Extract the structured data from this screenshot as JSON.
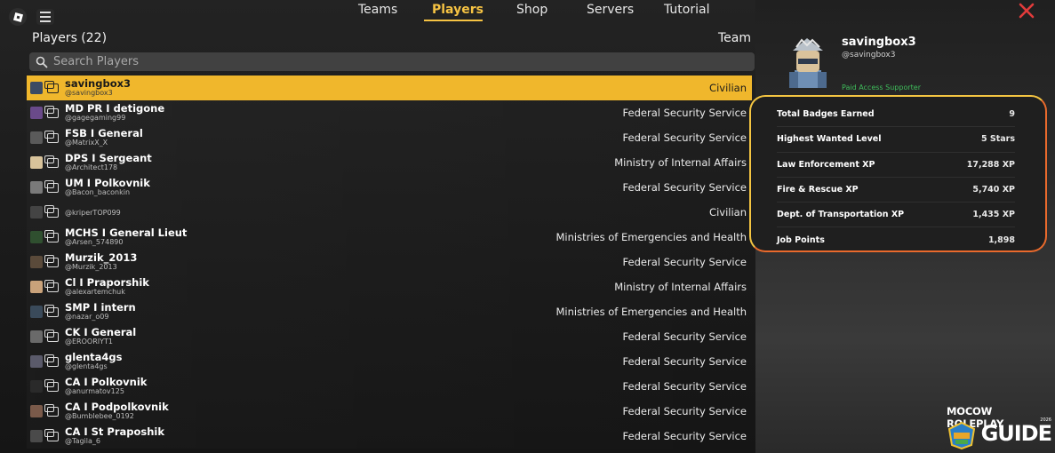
{
  "nav": {
    "tabs": [
      {
        "label": "Teams",
        "active": false
      },
      {
        "label": "Players",
        "active": true
      },
      {
        "label": "Shop",
        "active": false
      },
      {
        "label": "Servers",
        "active": false
      },
      {
        "label": "Tutorial",
        "active": false
      }
    ],
    "accent_color": "#f6c343",
    "close_color": "#e23b3b"
  },
  "players": {
    "title": "Players (22)",
    "team_header": "Team",
    "search_placeholder": "Search Players",
    "rows": [
      {
        "display": "savingbox3",
        "user": "@savingbox3",
        "team": "Civilian",
        "selected": true
      },
      {
        "display": "MD PR I detigone",
        "user": "@gagegaming99",
        "team": "Federal Security Service"
      },
      {
        "display": "FSB I General",
        "user": "@MatrixX_X",
        "team": "Federal Security Service"
      },
      {
        "display": "DPS I Sergeant",
        "user": "@Architect178",
        "team": "Ministry of Internal Affairs"
      },
      {
        "display": "UM I Polkovnik",
        "user": "@Bacon_baconkin",
        "team": "Federal Security Service"
      },
      {
        "display": "",
        "user": "@kriperTOP099",
        "team": "Civilian"
      },
      {
        "display": "MCHS I General Lieut",
        "user": "@Arsen_574890",
        "team": "Ministries of Emergencies and Health"
      },
      {
        "display": "Murzik_2013",
        "user": "@Murzik_2013",
        "team": "Federal Security Service"
      },
      {
        "display": "Cl I Praporshik",
        "user": "@alexartemchuk",
        "team": "Ministry of Internal Affairs"
      },
      {
        "display": "SMP I intern",
        "user": "@nazar_o09",
        "team": "Ministries of Emergencies and Health"
      },
      {
        "display": "CK I General",
        "user": "@EROORIYT1",
        "team": "Federal Security Service"
      },
      {
        "display": "glenta4gs",
        "user": "@glenta4gs",
        "team": "Federal Security Service"
      },
      {
        "display": "CA I Polkovnik",
        "user": "@anurmatov125",
        "team": "Federal Security Service"
      },
      {
        "display": "CA I Podpolkovnik",
        "user": "@Bumblebee_0192",
        "team": "Federal Security Service"
      },
      {
        "display": "CA I St Praposhik",
        "user": "@Tagila_6",
        "team": "Federal Security Service"
      }
    ]
  },
  "profile": {
    "name": "savingbox3",
    "user": "@savingbox3",
    "badge": "Paid Access Supporter",
    "stats": [
      {
        "label": "Total Badges Earned",
        "value": "9"
      },
      {
        "label": "Highest Wanted Level",
        "value": "5 Stars"
      },
      {
        "label": "Law Enforcement XP",
        "value": "17,288 XP"
      },
      {
        "label": "Fire & Rescue XP",
        "value": "5,740 XP"
      },
      {
        "label": "Dept. of Transportation XP",
        "value": "1,435 XP"
      },
      {
        "label": "Job Points",
        "value": "1,898"
      }
    ]
  },
  "watermark": {
    "line1": "MOCOW ROLEPLAY",
    "year": "2026",
    "line2": "GUIDE"
  }
}
